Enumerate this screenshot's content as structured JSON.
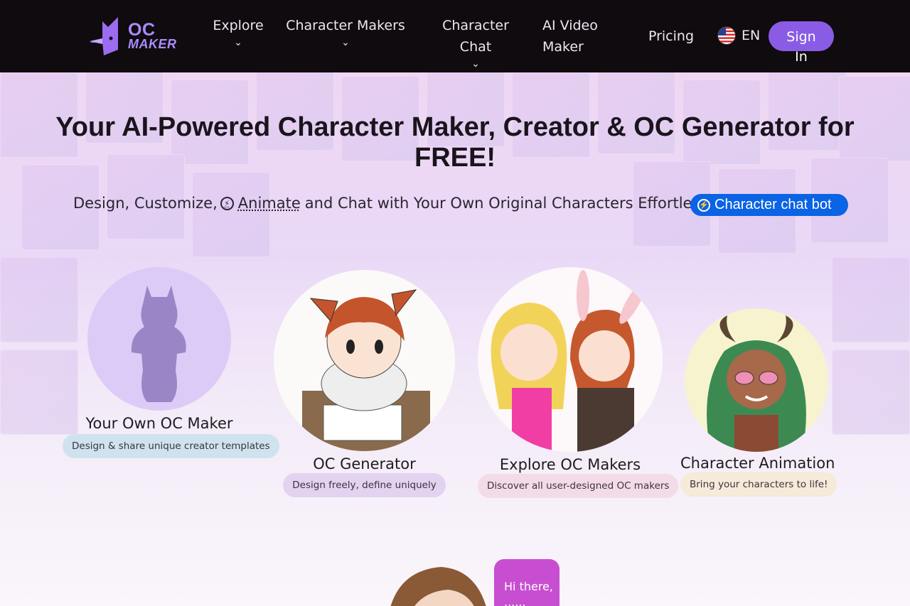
{
  "nav": {
    "logo_line1": "OC",
    "logo_line2": "MAKER",
    "items": [
      {
        "label": "Explore",
        "has_dropdown": true
      },
      {
        "label": "Character Makers",
        "has_dropdown": true
      },
      {
        "label": "Character Chat",
        "has_dropdown": true
      },
      {
        "label_line1": "AI Video",
        "label_line2": "Maker",
        "has_dropdown": false
      },
      {
        "label": "Pricing",
        "has_dropdown": false
      }
    ],
    "chevron": "⌄",
    "language": "EN",
    "sign_in": "Sign In"
  },
  "hero": {
    "title": "Your AI-Powered Character Maker, Creator & OC Generator for FREE!",
    "subtitle_prefix": "Design, Customize,",
    "subtitle_link": "Animate",
    "subtitle_suffix": "and Chat with Your Own Original Characters Effortlessly.",
    "chatbot_label": "Character chat bot"
  },
  "cards": [
    {
      "title": "Your Own OC Maker",
      "badge": "Design & share unique creator templates",
      "badge_color": "#cfe3ee"
    },
    {
      "title": "OC Generator",
      "badge": "Design freely, define uniquely",
      "badge_color": "#e3d2f0"
    },
    {
      "title": "Explore OC Makers",
      "badge": "Discover all user-designed OC makers",
      "badge_color": "#f4dbe8"
    },
    {
      "title": "Character Animation",
      "badge": "Bring your characters to life!",
      "badge_color": "#f6ead8"
    }
  ],
  "chat_preview": {
    "bubble_line1": "Hi there,",
    "bubble_line2": "......"
  },
  "colors": {
    "nav_bg": "#0f0b0e",
    "accent_purple": "#8a5ce6",
    "chatbot_blue": "#0b63e5",
    "logo_purple": "#a98bff"
  }
}
